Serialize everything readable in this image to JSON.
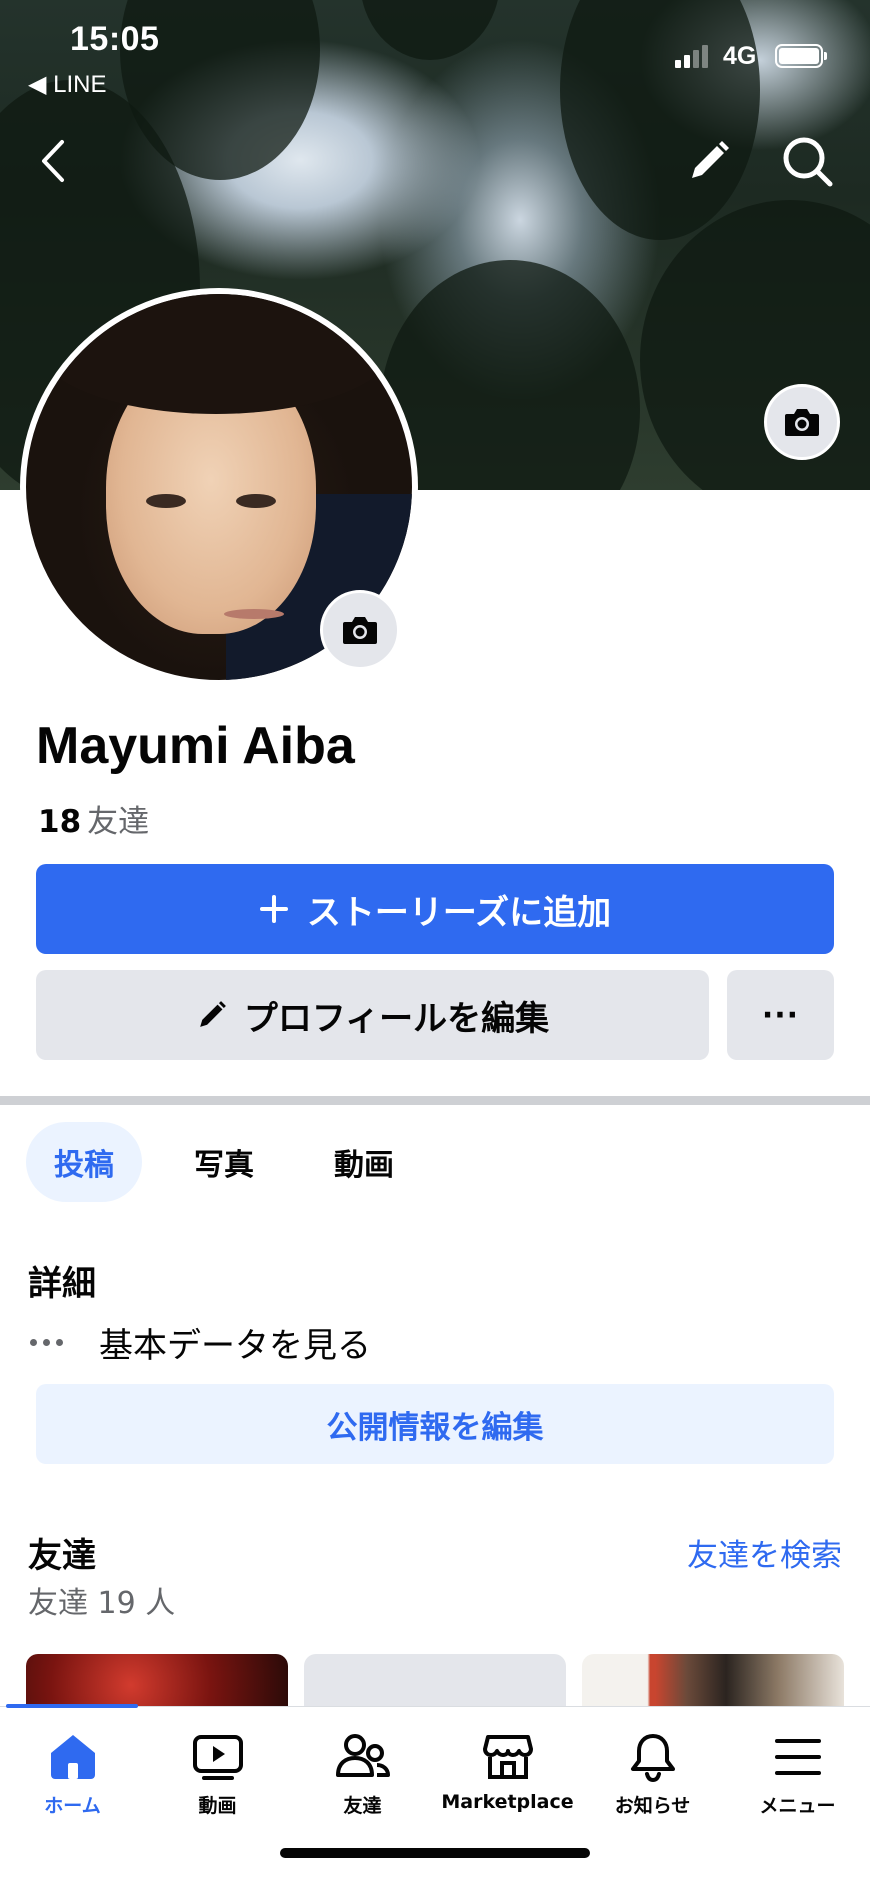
{
  "status_bar": {
    "time": "15:05",
    "back_app": "◀ LINE",
    "network": "4G"
  },
  "header": {
    "icons": [
      "back-chevron-icon",
      "pencil-icon",
      "search-icon",
      "camera-icon"
    ]
  },
  "profile": {
    "name": "Mayumi Aiba",
    "friend_count": "18",
    "friend_label": "友達",
    "add_story_label": "ストーリーズに追加",
    "edit_profile_label": "プロフィールを編集",
    "more_label": "···"
  },
  "tabs": [
    {
      "label": "投稿",
      "active": true
    },
    {
      "label": "写真",
      "active": false
    },
    {
      "label": "動画",
      "active": false
    }
  ],
  "details": {
    "title": "詳細",
    "basic_info_label": "基本データを見る",
    "edit_public_label": "公開情報を編集"
  },
  "friends": {
    "title": "友達",
    "search_link": "友達を検索",
    "count_text": "友達 19 人"
  },
  "bottom_nav": [
    {
      "label": "ホーム",
      "icon": "home-icon",
      "active": true
    },
    {
      "label": "動画",
      "icon": "video-icon",
      "active": false
    },
    {
      "label": "友達",
      "icon": "friends-icon",
      "active": false
    },
    {
      "label": "Marketplace",
      "icon": "marketplace-icon",
      "active": false
    },
    {
      "label": "お知らせ",
      "icon": "bell-icon",
      "active": false
    },
    {
      "label": "メニュー",
      "icon": "menu-icon",
      "active": false
    }
  ],
  "colors": {
    "accent": "#2f6af0",
    "secondary_button": "#e4e6eb",
    "light_accent_bg": "#ebf3ff",
    "muted_text": "#65676b"
  }
}
